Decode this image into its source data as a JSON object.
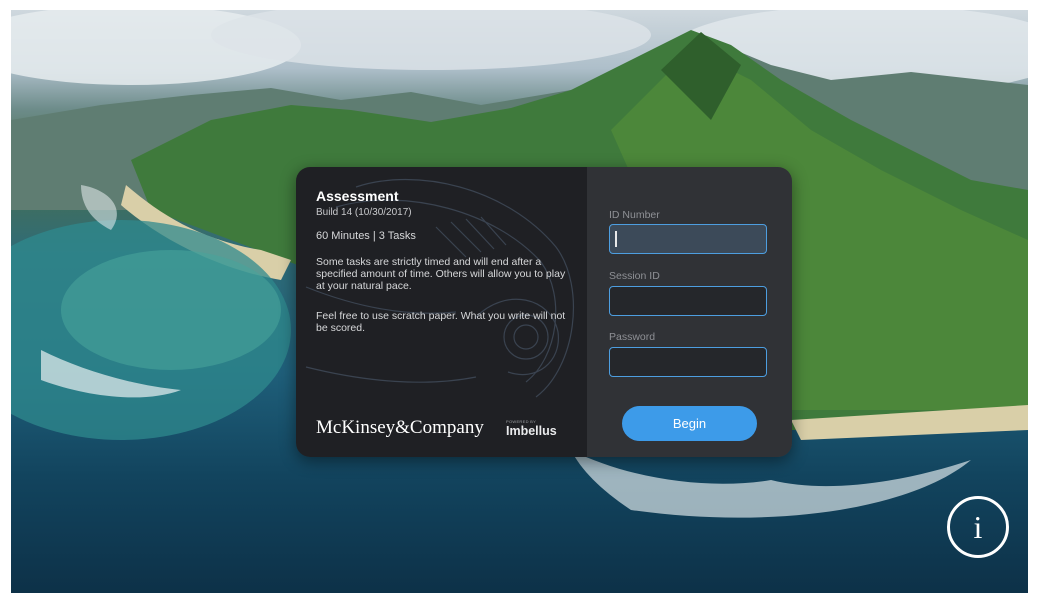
{
  "card": {
    "title": "Assessment",
    "build": "Build 14 (10/30/2017)",
    "duration": "60 Minutes | 3 Tasks",
    "paragraph1": "Some tasks are strictly timed and will end after a specified amount of time. Others will allow you to play at your natural pace.",
    "paragraph2": "Feel free to use scratch paper. What you write will not be scored.",
    "company": "McKinsey&Company",
    "powered_by": "POWERED BY",
    "partner": "Imbellus"
  },
  "form": {
    "id_label": "ID Number",
    "id_value": "",
    "session_label": "Session ID",
    "session_value": "",
    "password_label": "Password",
    "password_value": "",
    "begin_label": "Begin"
  },
  "icons": {
    "info": "info-icon",
    "info_glyph": "i"
  },
  "colors": {
    "accent": "#3d9be9",
    "input_border": "#4d9ee0",
    "panel_left": "#1f2024",
    "panel_right": "#303236"
  }
}
